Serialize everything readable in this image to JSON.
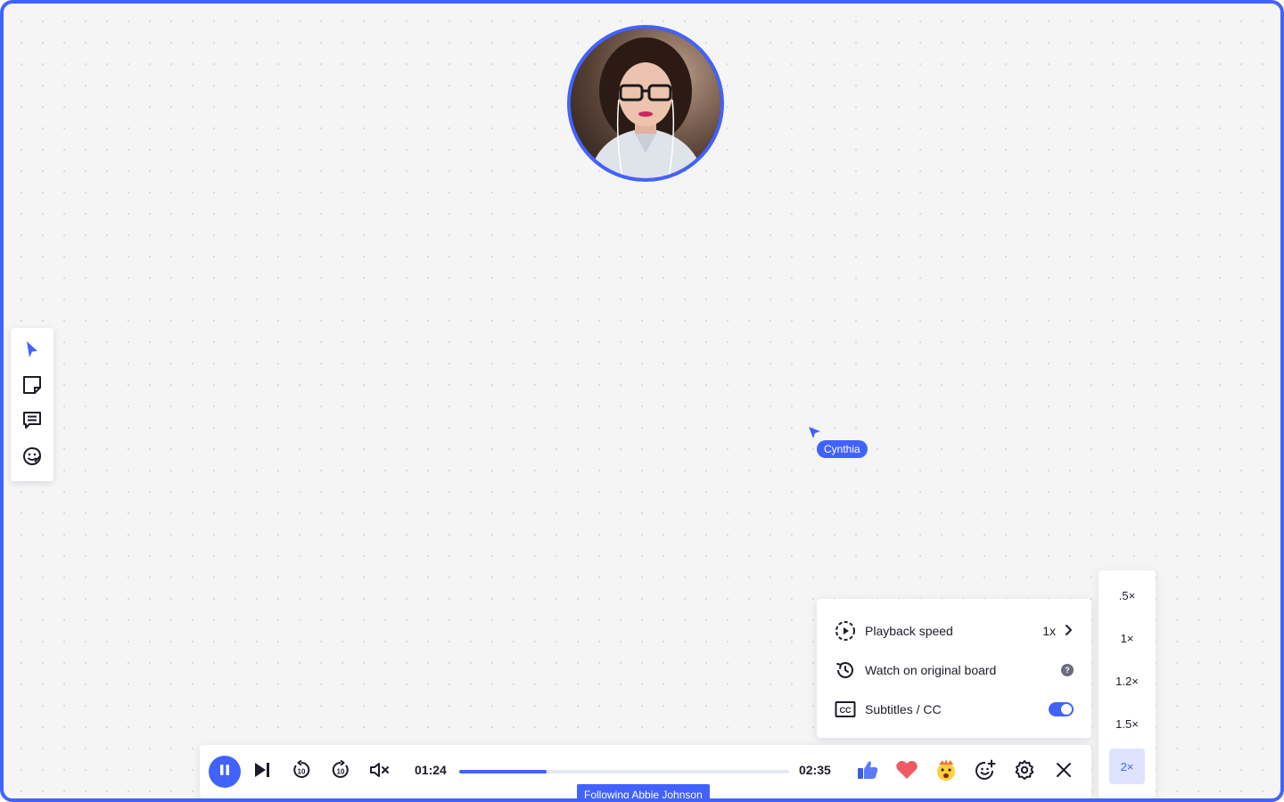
{
  "board": {
    "accent": "#4262ff",
    "background": "#f5f5f6"
  },
  "avatar": {
    "description": "presenter-video"
  },
  "toolbar": {
    "items": [
      {
        "name": "select",
        "icon": "cursor-icon"
      },
      {
        "name": "sticky-note",
        "icon": "sticky-note-icon"
      },
      {
        "name": "comment",
        "icon": "comment-icon"
      },
      {
        "name": "reactions",
        "icon": "sticker-icon"
      }
    ]
  },
  "cursor": {
    "user": "Cynthia"
  },
  "settings": {
    "playback_speed_label": "Playback speed",
    "playback_speed_value": "1x",
    "watch_original_label": "Watch on original board",
    "help_glyph": "?",
    "subtitles_label": "Subtitles / CC",
    "subtitles_on": true
  },
  "speeds": {
    "options": [
      ".5×",
      "1×",
      "1.2×",
      "1.5×",
      "2×"
    ],
    "selected": "2×"
  },
  "player": {
    "current_time": "01:24",
    "total_time": "02:35",
    "progress": 0.265,
    "following_label": "Following Abbie Johnson"
  }
}
